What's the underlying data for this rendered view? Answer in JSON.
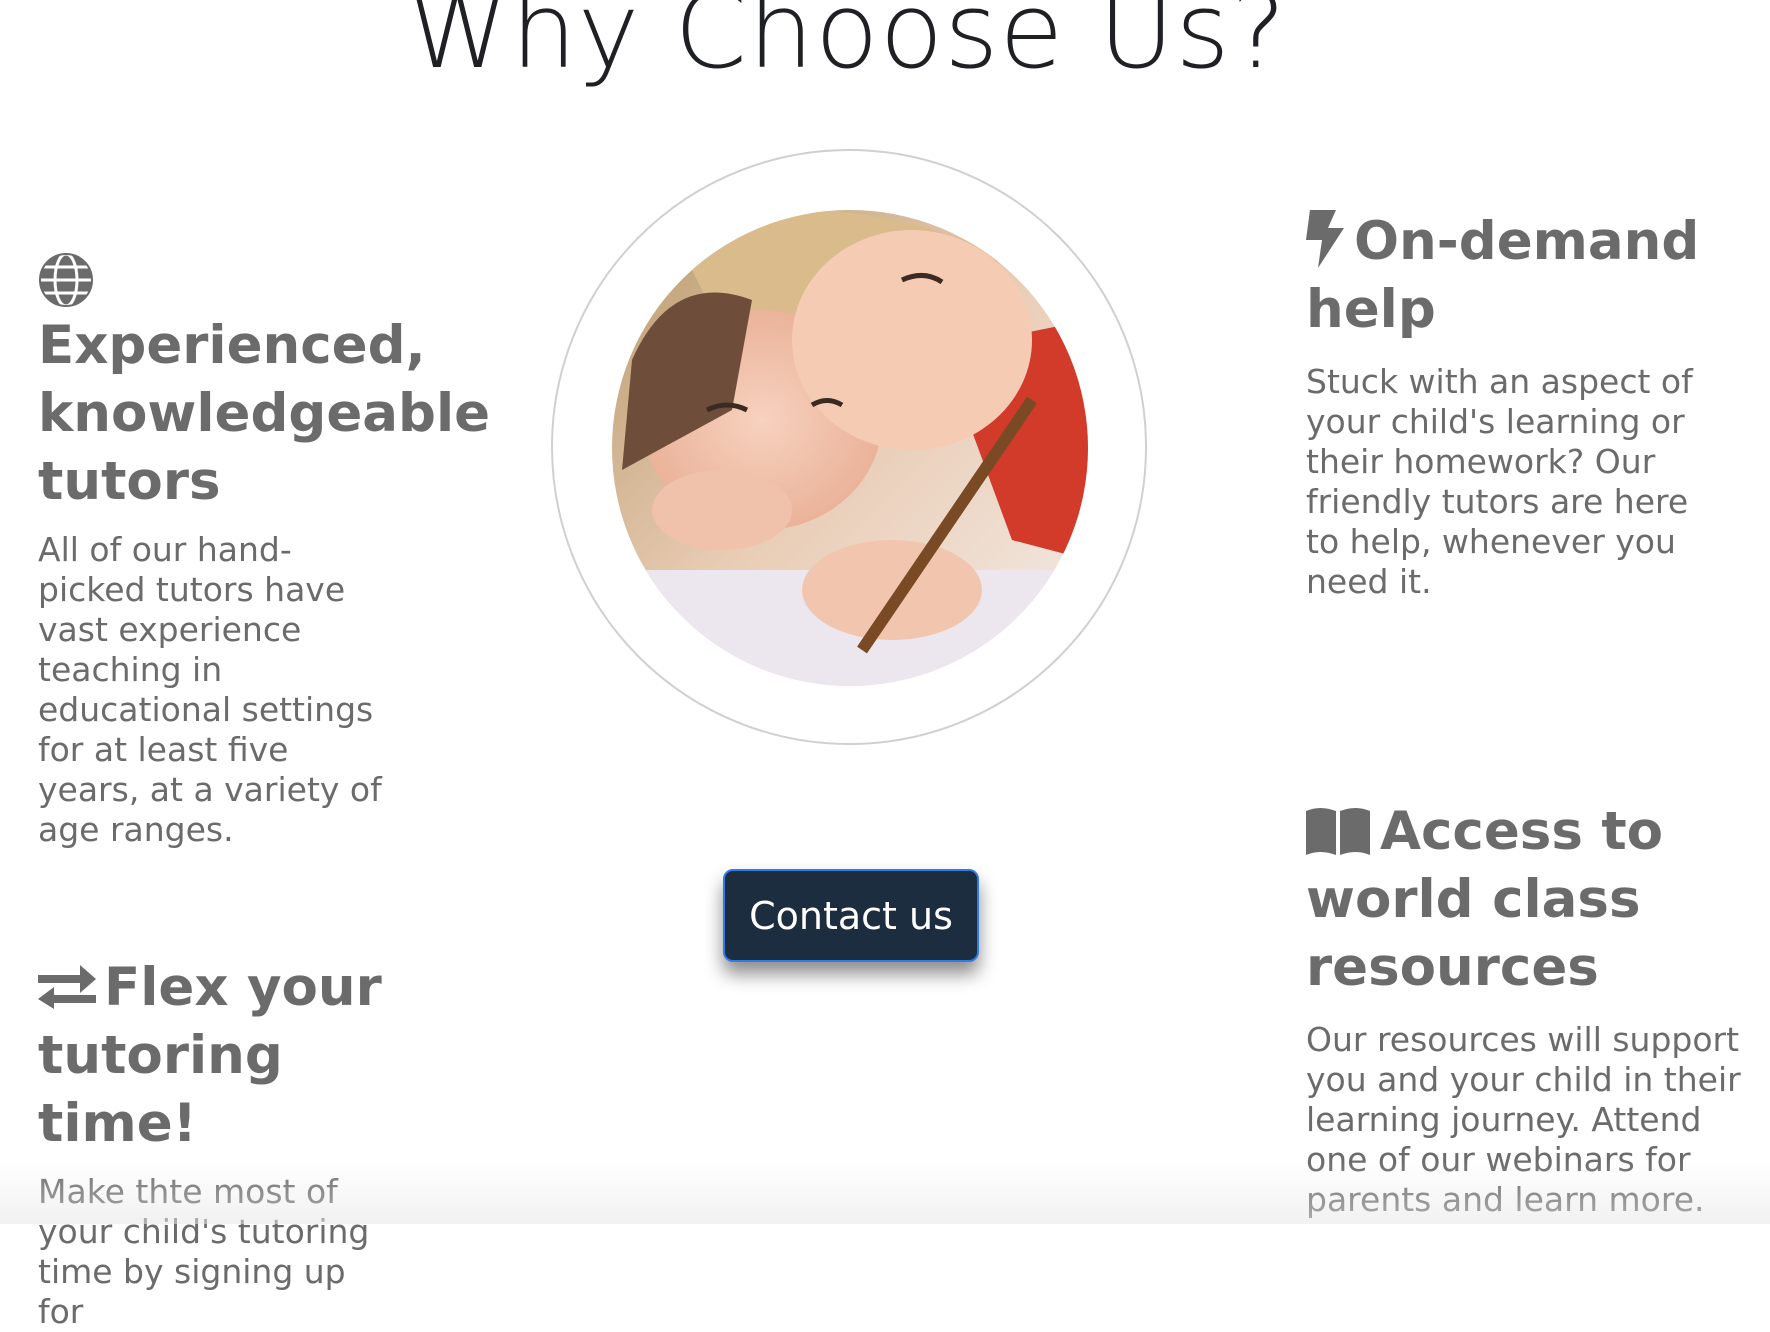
{
  "page": {
    "title": "Why Choose Us?"
  },
  "features": {
    "tutors": {
      "icon": "globe-icon",
      "heading": "Experienced, knowledgeable tutors",
      "text": "All of our hand-picked tutors have vast experience teaching in educational settings for at least five years, at a variety of age ranges."
    },
    "flex": {
      "icon": "exchange-arrows-icon",
      "heading": "Flex your tutoring time!",
      "text": "Make thte most of your child's tutoring time by signing up for"
    },
    "on_demand": {
      "icon": "lightning-bolt-icon",
      "heading": "On-demand help",
      "text": "Stuck with an aspect of your child's learning or their homework? Our friendly tutors are here to help, whenever you need it."
    },
    "resources": {
      "icon": "open-book-icon",
      "heading": "Access to world class resources",
      "text": "Our resources will support you and your child in their learning journey. Attend one of our webinars for parents and learn more."
    }
  },
  "hero_image": {
    "description": "children-drawing-photo"
  },
  "cta": {
    "label": "Contact us"
  },
  "colors": {
    "heading_text": "#6b6b6b",
    "title_text": "#1f2024",
    "button_bg": "#1c2d40",
    "button_border": "#2f7be8"
  }
}
